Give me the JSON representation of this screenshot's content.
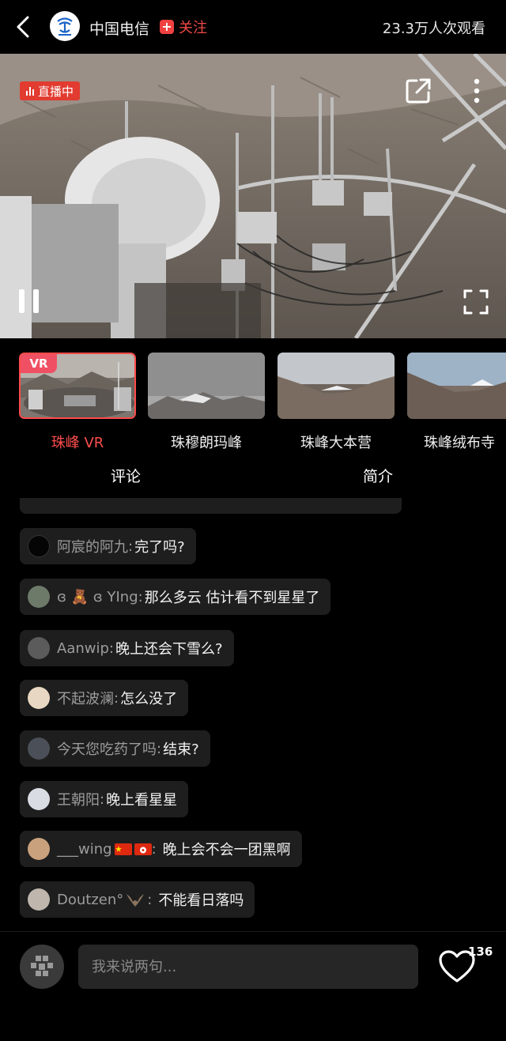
{
  "header": {
    "channel_name": "中国电信",
    "follow_label": "关注",
    "viewers": "23.3万人次观看",
    "icons": [
      "back-icon",
      "china-telecom-logo",
      "plus-icon"
    ]
  },
  "video": {
    "live_label": "直播中",
    "icons": [
      "share-icon",
      "more-icon",
      "pause-icon",
      "fullscreen-icon"
    ]
  },
  "cameras": [
    {
      "label": "珠峰 VR",
      "tag": "VR",
      "active": true
    },
    {
      "label": "珠穆朗玛峰",
      "active": false
    },
    {
      "label": "珠峰大本营",
      "active": false
    },
    {
      "label": "珠峰绒布寺",
      "active": false
    }
  ],
  "tabs": [
    {
      "label": "评论",
      "active": true
    },
    {
      "label": "简介",
      "active": false
    }
  ],
  "comments": [
    {
      "user": "阿宸的阿九",
      "text": "完了吗?"
    },
    {
      "user": "ɞ 🧸 ɞ YIng",
      "text": "那么多云 估计看不到星星了"
    },
    {
      "user": "Aanwip",
      "text": "晚上还会下雪么?"
    },
    {
      "user": "不起波澜",
      "text": "怎么没了"
    },
    {
      "user": "今天您吃药了吗",
      "text": "结束?"
    },
    {
      "user": "王朝阳",
      "text": "晚上看星星"
    },
    {
      "user": "___wing",
      "text": "晚上会不会一团黑啊"
    },
    {
      "user": "Doutzen°",
      "text": "不能看日落吗"
    }
  ],
  "colon": ":",
  "bottom": {
    "input_placeholder": "我来说两句...",
    "like_count": "136"
  },
  "colors": {
    "accent_red": "#f04040",
    "live_red": "#e23b30",
    "bubble_bg": "#1e1e1e"
  }
}
